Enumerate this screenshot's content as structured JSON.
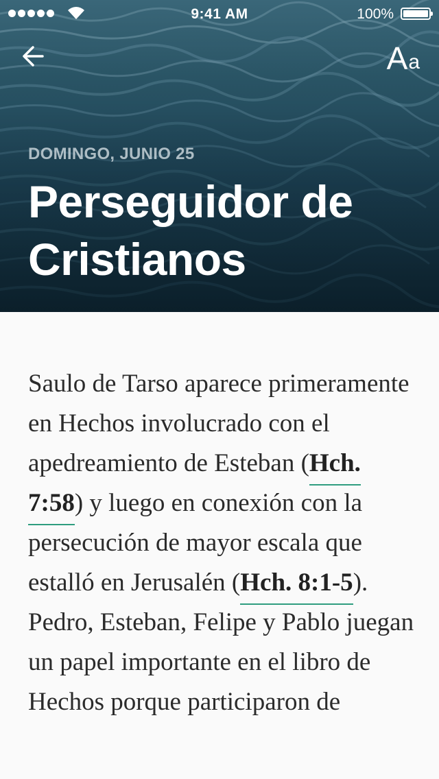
{
  "status_bar": {
    "time": "9:41 AM",
    "battery": "100%",
    "signal_icon": "signal-dots-icon",
    "wifi_icon": "wifi-icon",
    "battery_icon": "battery-icon"
  },
  "nav": {
    "back_icon": "arrow-left-icon",
    "font_button": {
      "large_letter": "A",
      "small_letter": "a",
      "icon": "font-size-icon"
    }
  },
  "header": {
    "date": "DOMINGO, JUNIO 25",
    "title": "Perseguidor de Cristianos",
    "background": "ocean-waves-image"
  },
  "body": {
    "segments": [
      "Saulo de Tarso aparece primeramente en Hechos involucrado con el apedreamiento de Esteban (",
      "Hch. 7:58",
      ") y luego en conexión con la persecución de mayor escala que estalló en Jerusalén (",
      "Hch. 8:1-5",
      "). Pedro, Esteban, Felipe y Pablo juegan un papel importante en el libro de Hechos porque participaron de"
    ]
  },
  "colors": {
    "link_underline": "#2e9d7f",
    "body_text": "#2b2b2b",
    "date_label": "#c7d3d9"
  }
}
